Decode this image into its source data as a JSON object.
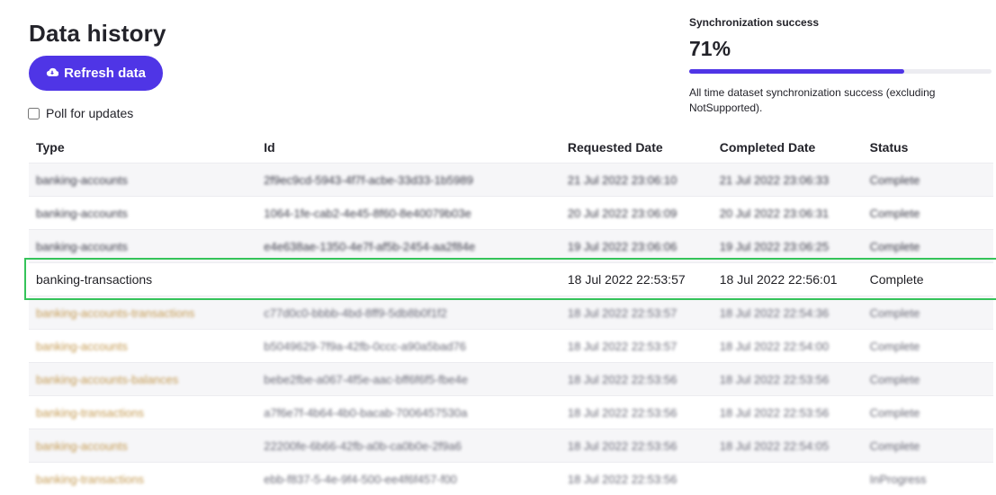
{
  "header": {
    "title": "Data history",
    "refresh_label": "Refresh data",
    "poll_label": "Poll for updates",
    "poll_checked": false
  },
  "sync": {
    "label": "Synchronization success",
    "value": "71%",
    "fraction": 0.71,
    "description": "All time dataset synchronization success (excluding NotSupported)."
  },
  "table": {
    "columns": [
      "Type",
      "Id",
      "Requested Date",
      "Completed Date",
      "Status"
    ],
    "rows": [
      {
        "type": "banking-accounts",
        "id": "2f9ec9cd-5943-4f7f-acbe-33d33-1b5989",
        "requested": "21 Jul 2022 23:06:10",
        "completed": "21 Jul 2022 23:06:33",
        "status": "Complete"
      },
      {
        "type": "banking-accounts",
        "id": "1064-1fe-cab2-4e45-8f60-8e40079b03e",
        "requested": "20 Jul 2022 23:06:09",
        "completed": "20 Jul 2022 23:06:31",
        "status": "Complete"
      },
      {
        "type": "banking-accounts",
        "id": "e4e638ae-1350-4e7f-af5b-2454-aa2f84e",
        "requested": "19 Jul 2022 23:06:06",
        "completed": "19 Jul 2022 23:06:25",
        "status": "Complete"
      },
      {
        "type": "banking-transactions",
        "id": "",
        "requested": "18 Jul 2022 22:53:57",
        "completed": "18 Jul 2022 22:56:01",
        "status": "Complete"
      },
      {
        "type": "banking-accounts-transactions",
        "id": "c77d0c0-bbbb-4bd-8ff9-5db8b0f1f2",
        "requested": "18 Jul 2022 22:53:57",
        "completed": "18 Jul 2022 22:54:36",
        "status": "Complete"
      },
      {
        "type": "banking-accounts",
        "id": "b5049629-7f9a-42fb-0ccc-a90a5bad76",
        "requested": "18 Jul 2022 22:53:57",
        "completed": "18 Jul 2022 22:54:00",
        "status": "Complete"
      },
      {
        "type": "banking-accounts-balances",
        "id": "bebe2fbe-a067-4f5e-aac-bff6f6f5-fbe4e",
        "requested": "18 Jul 2022 22:53:56",
        "completed": "18 Jul 2022 22:53:56",
        "status": "Complete"
      },
      {
        "type": "banking-transactions",
        "id": "a7f6e7f-4b64-4b0-bacab-7006457530a",
        "requested": "18 Jul 2022 22:53:56",
        "completed": "18 Jul 2022 22:53:56",
        "status": "Complete"
      },
      {
        "type": "banking-accounts",
        "id": "22200fe-6b66-42fb-a0b-ca0b0e-2f9a6",
        "requested": "18 Jul 2022 22:53:56",
        "completed": "18 Jul 2022 22:54:05",
        "status": "Complete"
      },
      {
        "type": "banking-transactions",
        "id": "ebb-f837-5-4e-9f4-500-ee4f6f457-f00",
        "requested": "18 Jul 2022 22:53:56",
        "completed": "",
        "status": "InProgress"
      }
    ]
  },
  "colors": {
    "accent": "#4f35e6",
    "highlight_border": "#35c35a"
  },
  "icons": {
    "refresh": "cloud-download-icon"
  }
}
